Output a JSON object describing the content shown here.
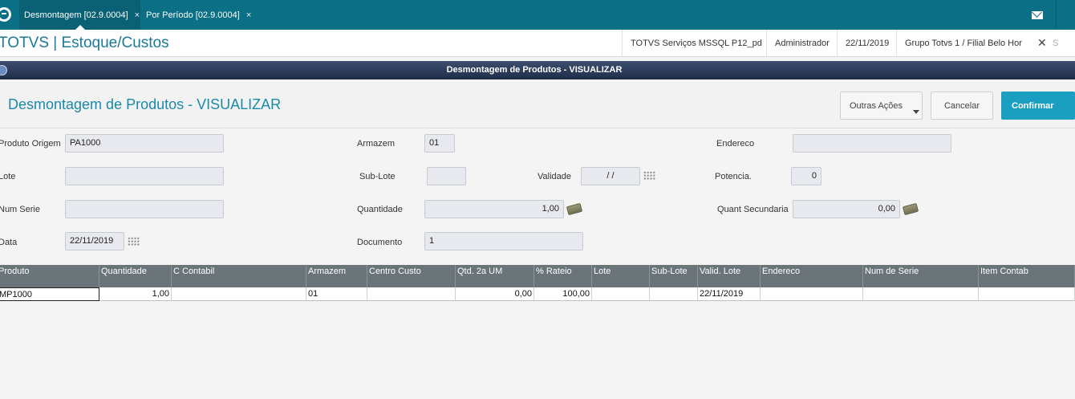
{
  "tabs": [
    {
      "label": "Desmontagem [02.9.0004]",
      "close": "×"
    },
    {
      "label": "Por Período [02.9.0004]",
      "close": "×"
    }
  ],
  "app": {
    "title": "TOTVS | Estoque/Custos",
    "environment": "TOTVS Serviços MSSQL P12_pd",
    "user": "Administrador",
    "date": "22/11/2019",
    "company": "Grupo Totvs 1 / Filial Belo Hor",
    "close_glyph": "✕",
    "close_label_fragment": "S"
  },
  "dialog": {
    "title": "Desmontagem de Produtos - VISUALIZAR"
  },
  "page": {
    "title": "Desmontagem de Produtos - VISUALIZAR",
    "buttons": {
      "more": "Outras Ações",
      "cancel": "Cancelar",
      "confirm": "Confirmar"
    }
  },
  "form": {
    "produto_origem": {
      "label": "Produto Origem",
      "value": "PA1000"
    },
    "armazem": {
      "label": "Armazem",
      "value": "01"
    },
    "endereco": {
      "label": "Endereco",
      "value": ""
    },
    "lote": {
      "label": "Lote",
      "value": ""
    },
    "sub_lote": {
      "label": "Sub-Lote",
      "value": ""
    },
    "validade": {
      "label": "Validade",
      "value": "/ /"
    },
    "potencia": {
      "label": "Potencia.",
      "value": "0"
    },
    "num_serie": {
      "label": "Num Serie",
      "value": ""
    },
    "quantidade": {
      "label": "Quantidade",
      "value": "1,00"
    },
    "quant_secundaria": {
      "label": "Quant Secundaria",
      "value": "0,00"
    },
    "data": {
      "label": "Data",
      "value": "22/11/2019"
    },
    "documento": {
      "label": "Documento",
      "value": "1"
    }
  },
  "grid": {
    "columns": [
      "Produto",
      "Quantidade",
      "C Contabil",
      "Armazem",
      "Centro Custo",
      "Qtd. 2a UM",
      "% Rateio",
      "Lote",
      "Sub-Lote",
      "Valid. Lote",
      "Endereco",
      "Num de Serie",
      "Item Contab"
    ],
    "rows": [
      [
        "MP1000",
        "1,00",
        "",
        "01",
        "",
        "0,00",
        "100,00",
        "",
        "",
        "22/11/2019",
        "",
        "",
        ""
      ]
    ]
  },
  "icons": {
    "logo": "totvs-logo-icon",
    "mail": "mail-icon",
    "calendar": "calendar-icon",
    "money": "money-icon"
  },
  "colors": {
    "topbar": "#0b6f86",
    "accent": "#1a9ec2",
    "dialog_bar": "#2a3a58",
    "grid_header": "#6b7479"
  }
}
